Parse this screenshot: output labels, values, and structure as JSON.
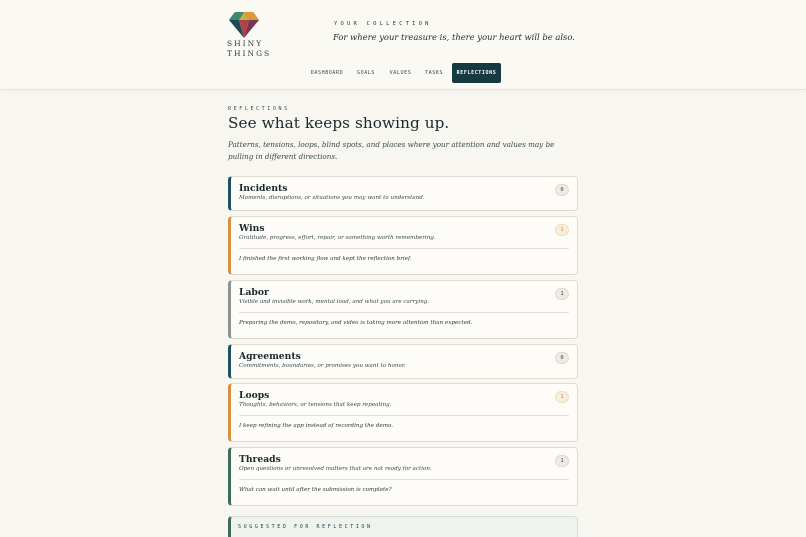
{
  "brand": {
    "name_line1": "SHINY",
    "name_line2": "THINGS"
  },
  "header": {
    "collection_label": "YOUR COLLECTION",
    "tagline": "For where your treasure is, there your heart will be also."
  },
  "nav": {
    "items": [
      {
        "label": "DASHBOARD",
        "active": false
      },
      {
        "label": "GOALS",
        "active": false
      },
      {
        "label": "VALUES",
        "active": false
      },
      {
        "label": "TASKS",
        "active": false
      },
      {
        "label": "REFLECTIONS",
        "active": true
      }
    ]
  },
  "page": {
    "section_label": "REFLECTIONS",
    "title": "See what keeps showing up.",
    "description": "Patterns, tensions, loops, blind spots, and places where your attention and values may be pulling in different directions."
  },
  "cards": [
    {
      "title": "Incidents",
      "subtitle": "Moments, disruptions, or situations you may want to understand.",
      "count": "0",
      "entry": "",
      "accent": "blue"
    },
    {
      "title": "Wins",
      "subtitle": "Gratitude, progress, effort, repair, or something worth remembering.",
      "count": "1",
      "entry": "I finished the first working flow and kept the reflection brief.",
      "accent": "orange"
    },
    {
      "title": "Labor",
      "subtitle": "Visible and invisible work, mental load, and what you are carrying.",
      "count": "1",
      "entry": "Preparing the demo, repository, and video is taking more attention than expected.",
      "accent": "gray"
    },
    {
      "title": "Agreements",
      "subtitle": "Commitments, boundaries, or promises you want to honor.",
      "count": "0",
      "entry": "",
      "accent": "blue"
    },
    {
      "title": "Loops",
      "subtitle": "Thoughts, behaviors, or tensions that keep repeating.",
      "count": "1",
      "entry": "I keep refining the app instead of recording the demo.",
      "accent": "orange"
    },
    {
      "title": "Threads",
      "subtitle": "Open questions or unresolved matters that are not ready for action.",
      "count": "1",
      "entry": "What can wait until after the submission is complete?",
      "accent": "green"
    }
  ],
  "suggestion": {
    "label": "SUGGESTED FOR REFLECTION"
  },
  "colors": {
    "nav_active_bg": "#163a41",
    "accent_blue": "#1e4f62",
    "accent_orange": "#d9913f",
    "accent_gray": "#8a9294",
    "accent_green": "#3d6b5c",
    "background": "#f7f6f0"
  }
}
